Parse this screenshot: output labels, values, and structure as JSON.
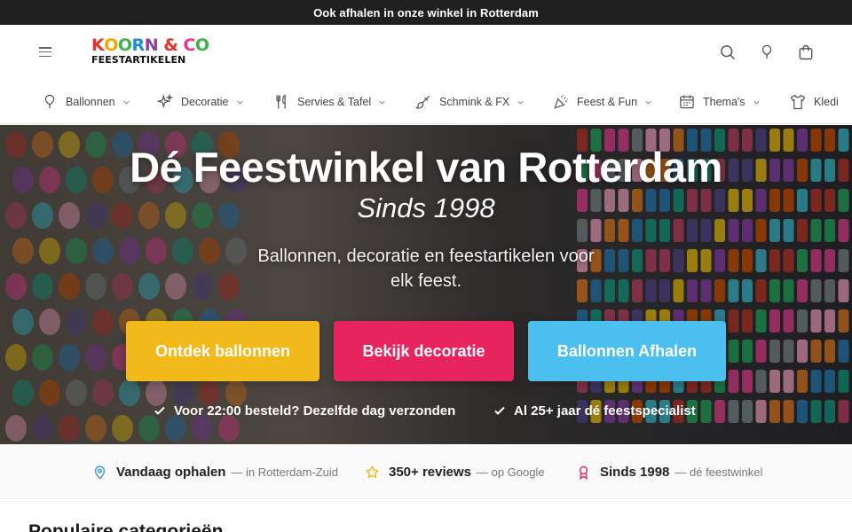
{
  "announcement": "Ook afhalen in onze winkel in Rotterdam",
  "header": {
    "logo_top": [
      {
        "ch": "K",
        "color": "#e63329"
      },
      {
        "ch": "O",
        "color": "#f6a400"
      },
      {
        "ch": "O",
        "color": "#3bb54a"
      },
      {
        "ch": "R",
        "color": "#1a8ed6"
      },
      {
        "ch": "N",
        "color": "#8e3fa6"
      },
      {
        "ch": " ",
        "color": "#000000"
      },
      {
        "ch": "&",
        "color": "#e63329"
      },
      {
        "ch": " ",
        "color": "#000000"
      },
      {
        "ch": "C",
        "color": "#e9358c"
      },
      {
        "ch": "O",
        "color": "#3bb54a"
      }
    ],
    "logo_bottom": "FEESTARTIKELEN",
    "icons": [
      "menu-icon",
      "search-icon",
      "wishlist-icon",
      "cart-icon"
    ]
  },
  "nav": {
    "items": [
      {
        "label": "Ballonnen",
        "icon": "balloon-icon"
      },
      {
        "label": "Decoratie",
        "icon": "sparkles-icon"
      },
      {
        "label": "Servies & Tafel",
        "icon": "cutlery-icon"
      },
      {
        "label": "Schmink & FX",
        "icon": "brush-icon"
      },
      {
        "label": "Feest & Fun",
        "icon": "party-popper-icon"
      },
      {
        "label": "Thema's",
        "icon": "calendar-icon"
      },
      {
        "label": "Kledi",
        "icon": "shirt-icon"
      }
    ]
  },
  "hero": {
    "title": "Dé Feestwinkel van Rotterdam",
    "subtitle": "Sinds 1998",
    "text": "Ballonnen, decoratie en feestartikelen voor elk feest.",
    "buttons": [
      {
        "label": "Ontdek ballonnen",
        "color": "#f2b91b"
      },
      {
        "label": "Bekijk decoratie",
        "color": "#e8245f"
      },
      {
        "label": "Ballonnen Afhalen",
        "color": "#4bbfee"
      }
    ],
    "checks": [
      "Voor 22:00 besteld? Dezelfde dag verzonden",
      "Al 25+ jaar dé feestspecialist"
    ]
  },
  "usp": [
    {
      "strong": "Vandaag ophalen",
      "light": "— in Rotterdam-Zuid",
      "icon": "location-pin-icon",
      "color": "#3a9bd8"
    },
    {
      "strong": "350+ reviews",
      "light": "— op Google",
      "icon": "star-icon",
      "color": "#f2b91b"
    },
    {
      "strong": "Sinds 1998",
      "light": "— dé feestwinkel",
      "icon": "award-icon",
      "color": "#e8245f"
    }
  ],
  "section_title": "Populaire categorieën"
}
